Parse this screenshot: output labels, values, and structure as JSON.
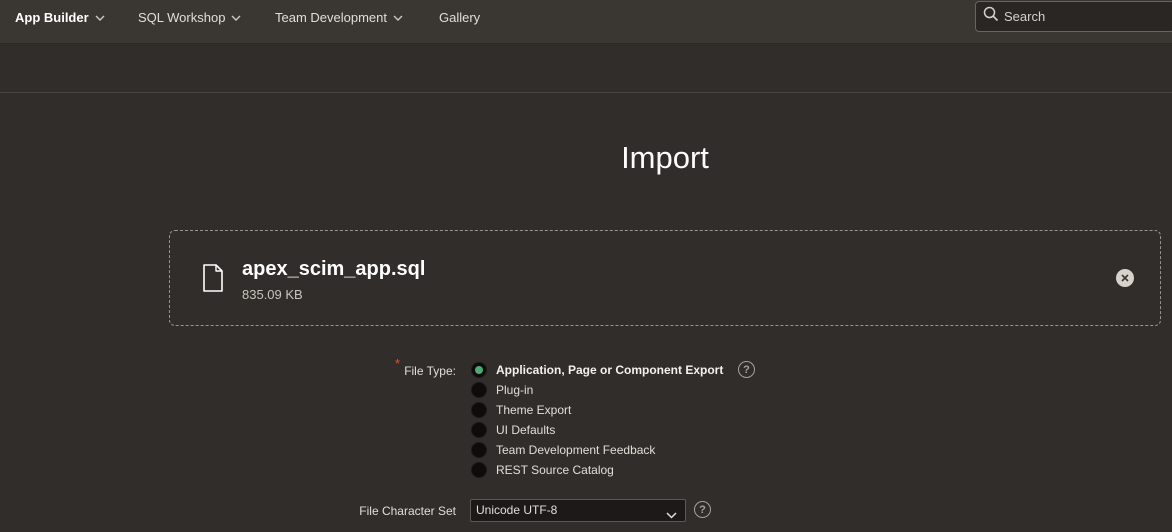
{
  "nav": {
    "items": [
      {
        "label": "App Builder",
        "has_menu": true,
        "active": true
      },
      {
        "label": "SQL Workshop",
        "has_menu": true,
        "active": false
      },
      {
        "label": "Team Development",
        "has_menu": true,
        "active": false
      },
      {
        "label": "Gallery",
        "has_menu": false,
        "active": false
      }
    ],
    "search": {
      "placeholder": "Search",
      "icon": "search-icon"
    }
  },
  "page": {
    "title": "Import"
  },
  "upload": {
    "file_name": "apex_scim_app.sql",
    "file_size": "835.09 KB",
    "icon": "file-icon",
    "remove_icon": "close-icon"
  },
  "form": {
    "file_type": {
      "label": "File Type:",
      "required": true,
      "options": [
        {
          "label": "Application, Page or Component Export",
          "selected": true
        },
        {
          "label": "Plug-in",
          "selected": false
        },
        {
          "label": "Theme Export",
          "selected": false
        },
        {
          "label": "UI Defaults",
          "selected": false
        },
        {
          "label": "Team Development Feedback",
          "selected": false
        },
        {
          "label": "REST Source Catalog",
          "selected": false
        }
      ]
    },
    "charset": {
      "label": "File Character Set",
      "value": "Unicode UTF-8"
    }
  },
  "colors": {
    "background": "#312d2a",
    "nav_background": "#3a3632",
    "selected_radio": "#4fa878",
    "required_marker": "#e0523c"
  }
}
